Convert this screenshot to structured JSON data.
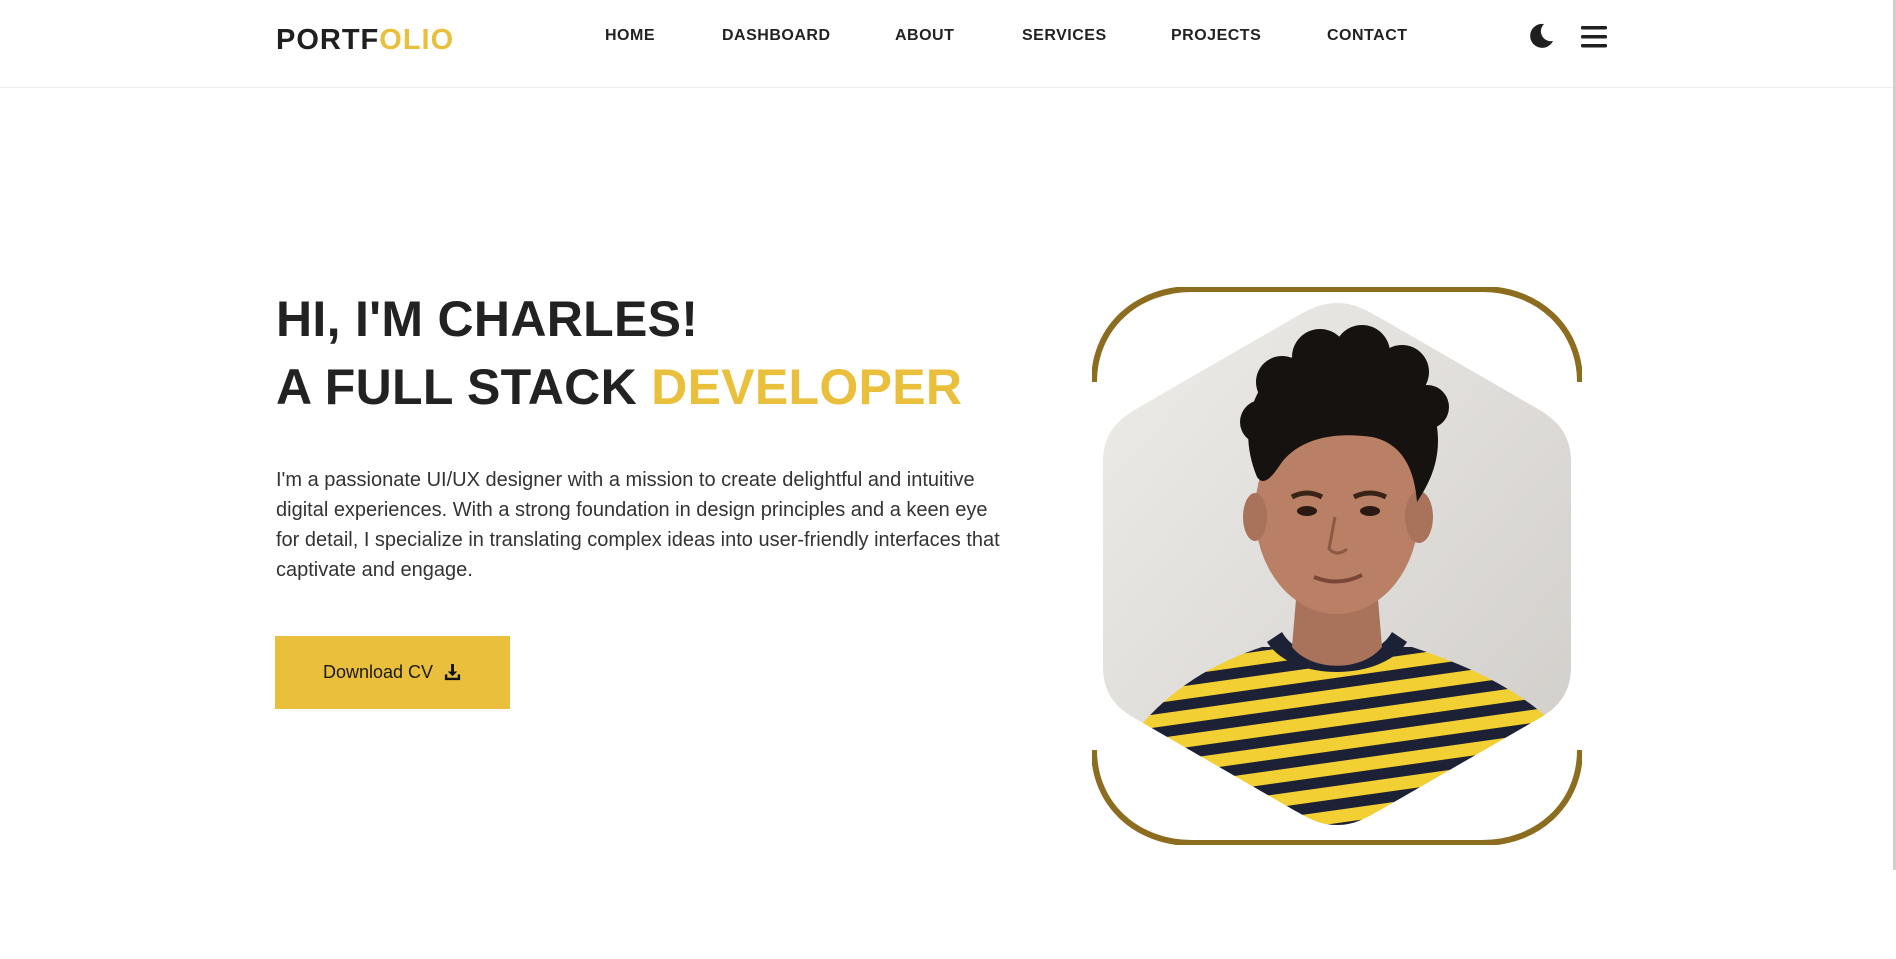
{
  "brand": {
    "logo_part1": "PORTF",
    "logo_part2": "OLIO",
    "accent_color": "#e9bf3c"
  },
  "nav": {
    "items": [
      {
        "label": "HOME"
      },
      {
        "label": "DASHBOARD"
      },
      {
        "label": "ABOUT"
      },
      {
        "label": "SERVICES"
      },
      {
        "label": "PROJECTS"
      },
      {
        "label": "CONTACT"
      }
    ],
    "icons": [
      "moon-icon",
      "menu-icon"
    ]
  },
  "hero": {
    "title_line1": "HI, I'M CHARLES!",
    "title_line2_prefix": "A FULL STACK ",
    "title_line2_accent": "DEVELOPER",
    "description": "I'm a passionate UI/UX designer with a mission to create delightful and intuitive digital experiences. With a strong foundation in design principles and a keen eye for detail, I specialize in translating complex ideas into user-friendly interfaces that captivate and engage.",
    "cv_button_label": "Download CV",
    "cv_icon": "download-icon",
    "frame_color": "#8c6d1f"
  }
}
